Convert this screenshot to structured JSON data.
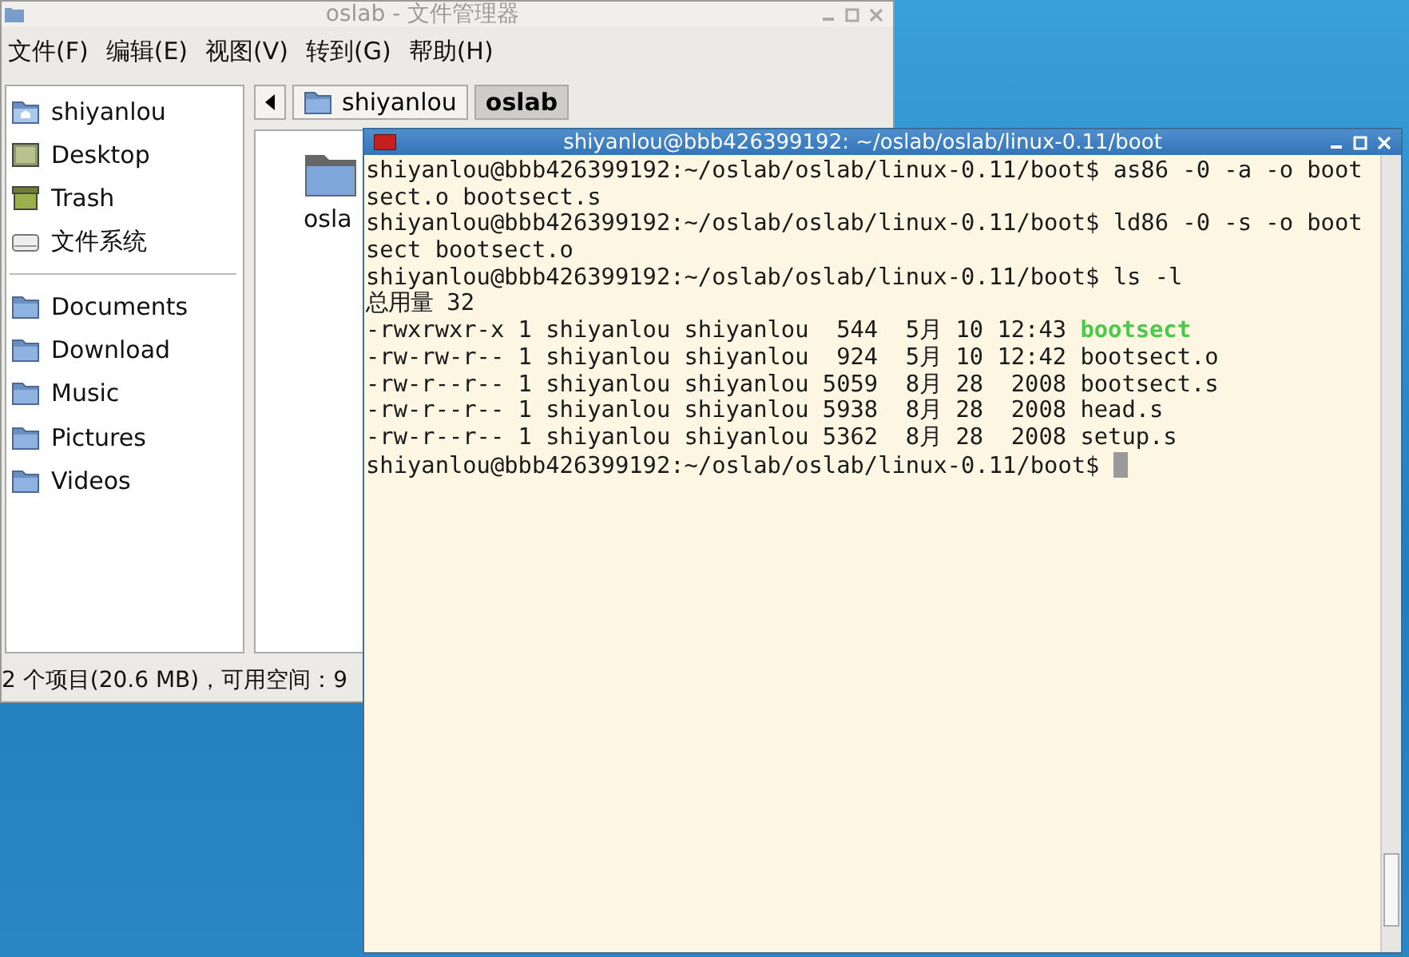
{
  "file_manager": {
    "title": "oslab - 文件管理器",
    "menu": [
      "文件(F)",
      "编辑(E)",
      "视图(V)",
      "转到(G)",
      "帮助(H)"
    ],
    "places": [
      {
        "label": "shiyanlou"
      },
      {
        "label": "Desktop"
      },
      {
        "label": "Trash"
      },
      {
        "label": "文件系统"
      }
    ],
    "bookmarks": [
      {
        "label": "Documents"
      },
      {
        "label": "Download"
      },
      {
        "label": "Music"
      },
      {
        "label": "Pictures"
      },
      {
        "label": "Videos"
      }
    ],
    "path": [
      {
        "label": "shiyanlou",
        "selected": false
      },
      {
        "label": "oslab",
        "selected": true
      }
    ],
    "items": [
      {
        "label": "osla"
      }
    ],
    "status_bar": "2 个项目(20.6 MB)，可用空间：9"
  },
  "terminal": {
    "title": "shiyanlou@bbb426399192: ~/oslab/oslab/linux-0.11/boot",
    "lines": [
      {
        "text": "shiyanlou@bbb426399192:~/oslab/oslab/linux-0.11/boot$ as86 -0 -a -o boot"
      },
      {
        "text": "sect.o bootsect.s"
      },
      {
        "text": "shiyanlou@bbb426399192:~/oslab/oslab/linux-0.11/boot$ ld86 -0 -s -o boot"
      },
      {
        "text": "sect bootsect.o"
      },
      {
        "text": "shiyanlou@bbb426399192:~/oslab/oslab/linux-0.11/boot$ ls -l"
      },
      {
        "text": "总用量 32"
      },
      {
        "text": "-rwxrwxr-x 1 shiyanlou shiyanlou  544  5月 10 12:43 ",
        "name": "bootsect",
        "kind": "executable"
      },
      {
        "text": "-rw-rw-r-- 1 shiyanlou shiyanlou  924  5月 10 12:42 ",
        "name": "bootsect.o",
        "kind": "file"
      },
      {
        "text": "-rw-r--r-- 1 shiyanlou shiyanlou 5059  8月 28  2008 ",
        "name": "bootsect.s",
        "kind": "file"
      },
      {
        "text": "-rw-r--r-- 1 shiyanlou shiyanlou 5938  8月 28  2008 ",
        "name": "head.s",
        "kind": "file"
      },
      {
        "text": "-rw-r--r-- 1 shiyanlou shiyanlou 5362  8月 28  2008 ",
        "name": "setup.s",
        "kind": "file"
      },
      {
        "text": "shiyanlou@bbb426399192:~/oslab/oslab/linux-0.11/boot$ ",
        "cursor": true
      }
    ]
  }
}
